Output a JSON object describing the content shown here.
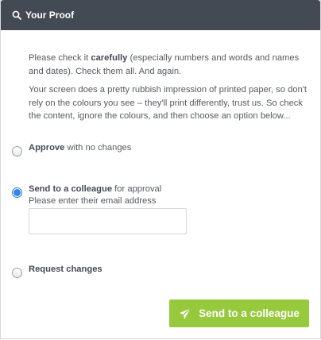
{
  "header": {
    "title": "Your Proof",
    "icon": "search-icon"
  },
  "intro": {
    "p1_before": "Please check it ",
    "p1_bold": "carefully",
    "p1_after": " (especially numbers and words and names and dates). Check them all. And again.",
    "p2": "Your screen does a pretty rubbish impression of printed paper, so don't rely on the colours you see – they'll print differently, trust us. So check the content, ignore the colours, and then choose an option below..."
  },
  "options": [
    {
      "bold": "Approve",
      "rest": " with no changes",
      "checked": false
    },
    {
      "bold": "Send to a colleague",
      "rest": " for approval",
      "checked": true
    },
    {
      "bold": "Request changes",
      "rest": "",
      "checked": false
    }
  ],
  "colleague": {
    "hint": "Please enter their email address",
    "email_value": "",
    "email_placeholder": ""
  },
  "submit": {
    "label": "Send to a colleague",
    "icon": "paper-plane-icon",
    "color": "#97c93d"
  },
  "colors": {
    "header_bg": "#444a54",
    "text": "#555a61",
    "radio_selected": "#2f86e8"
  }
}
